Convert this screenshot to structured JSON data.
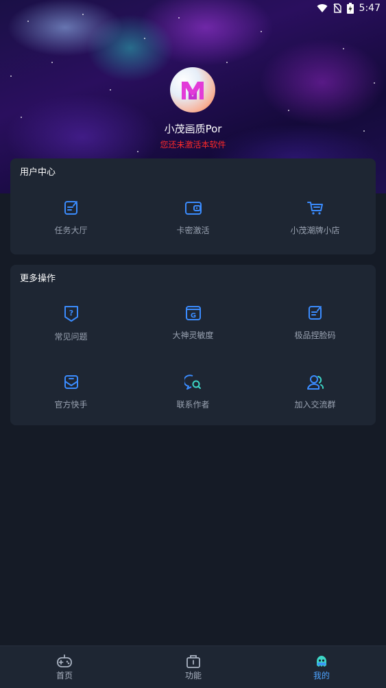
{
  "status_bar": {
    "time": "5:47"
  },
  "profile": {
    "name": "小茂画质Por",
    "notice": "您还未激活本软件"
  },
  "user_center": {
    "title": "用户中心",
    "items": [
      {
        "label": "任务大厅",
        "icon": "task-edit-icon"
      },
      {
        "label": "卡密激活",
        "icon": "card-wallet-icon"
      },
      {
        "label": "小茂潮牌小店",
        "icon": "shopping-cart-icon"
      }
    ]
  },
  "more_actions": {
    "title": "更多操作",
    "items": [
      {
        "label": "常见问题",
        "icon": "question-shield-icon"
      },
      {
        "label": "大神灵敏度",
        "icon": "g-window-icon"
      },
      {
        "label": "极品捏脸码",
        "icon": "edit-note-icon"
      },
      {
        "label": "官方快手",
        "icon": "inbox-icon"
      },
      {
        "label": "联系作者",
        "icon": "chat-search-icon"
      },
      {
        "label": "加入交流群",
        "icon": "group-users-icon"
      }
    ]
  },
  "bottom_nav": {
    "items": [
      {
        "label": "首页",
        "icon": "gamepad-icon"
      },
      {
        "label": "功能",
        "icon": "toolbox-icon"
      },
      {
        "label": "我的",
        "icon": "mascot-icon",
        "active": true
      }
    ]
  },
  "colors": {
    "background": "#151b26",
    "card": "#1e2633",
    "accent": "#3b8cff",
    "notice": "#ff2a2a"
  }
}
